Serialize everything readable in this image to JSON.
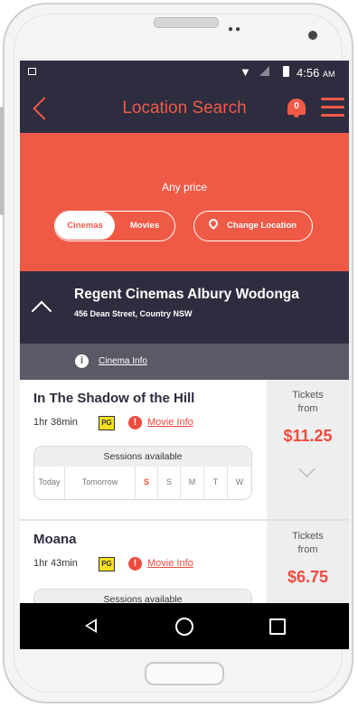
{
  "status_bar": {
    "time": "4:56",
    "ampm": "AM"
  },
  "header": {
    "title": "Location Search",
    "notification_count": "0"
  },
  "filter": {
    "price_label": "Any price",
    "toggle": [
      {
        "label": "Cinemas",
        "selected": true
      },
      {
        "label": "Movies",
        "selected": false
      }
    ],
    "change_location_label": "Change Location"
  },
  "cinema": {
    "name": "Regent Cinemas Albury Wodonga",
    "address": "456 Dean Street, Country NSW",
    "info_label": "Cinema Info"
  },
  "movies": [
    {
      "title": "In The Shadow of the Hill",
      "duration": "1hr 38min",
      "rating": "PG",
      "info_label": "Movie Info",
      "sessions_label": "Sessions available",
      "days": [
        "Today",
        "Tomorrow",
        "S",
        "S",
        "M",
        "T",
        "W"
      ],
      "tickets_label": "Tickets from",
      "price": "$11.25"
    },
    {
      "title": "Moana",
      "duration": "1hr 43min",
      "rating": "PG",
      "info_label": "Movie Info",
      "sessions_label": "Sessions available",
      "tickets_label": "Tickets from",
      "price": "$6.75"
    }
  ],
  "colors": {
    "accent": "#ef5a47",
    "dark": "#2e2c3f",
    "info_bar": "#5b5966"
  }
}
